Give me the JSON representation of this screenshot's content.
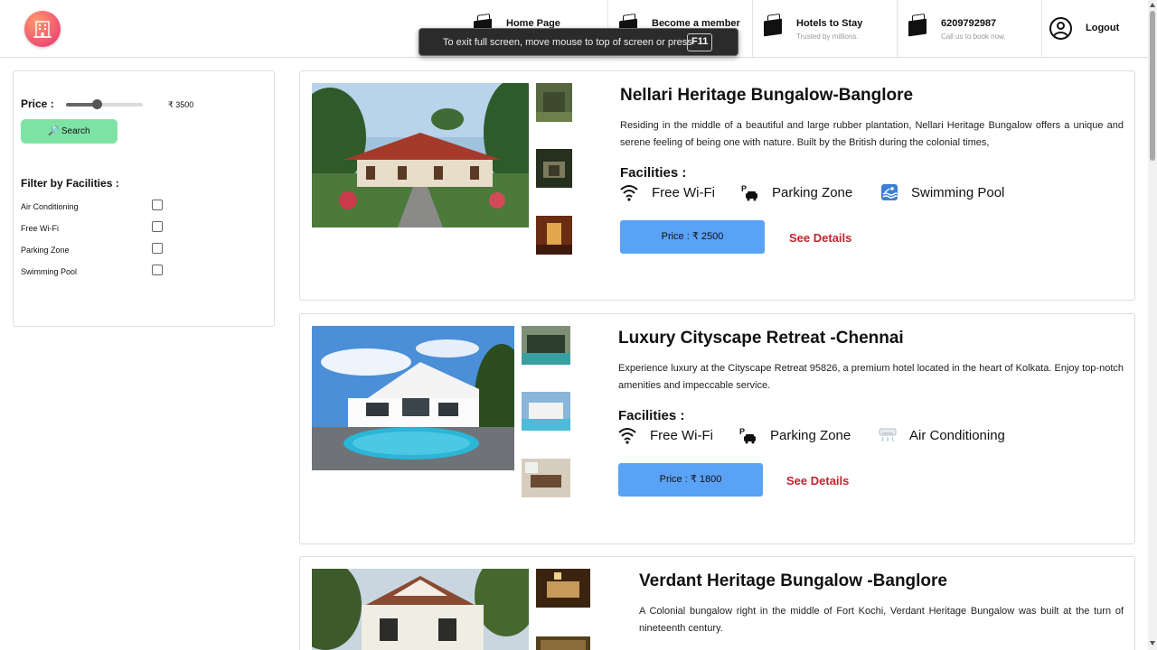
{
  "header": {
    "nav": [
      {
        "title": "Home Page",
        "subtitle": ""
      },
      {
        "title": "Become a member",
        "subtitle": ""
      },
      {
        "title": "Hotels to Stay",
        "subtitle": "Trusted by millions."
      },
      {
        "title": "6209792987",
        "subtitle": "Call us to book now."
      }
    ],
    "logout_label": "Logout"
  },
  "fullscreen_toast": {
    "message": "To exit full screen, move mouse to top of screen or press",
    "key": "F11"
  },
  "sidebar": {
    "price_label": "Price :",
    "price_value": "₹ 3500",
    "price_slider_fraction": 0.4,
    "search_label": "Search",
    "filter_title": "Filter by Facilities :",
    "facilities": [
      "Air Conditioning",
      "Free Wi-Fi",
      "Parking Zone",
      "Swimming Pool"
    ]
  },
  "hotels": [
    {
      "name": "Nellari Heritage Bungalow-Banglore",
      "description": "Residing in the middle of a beautiful and large rubber plantation, Nellari Heritage Bungalow offers a unique and serene feeling of being one with nature. Built by the British during the colonial times,",
      "facilities_title": "Facilities :",
      "facilities": [
        "Free Wi-Fi",
        "Parking Zone",
        "Swimming Pool"
      ],
      "price": "Price : ₹ 2500",
      "details": "See Details"
    },
    {
      "name": "Luxury Cityscape Retreat -Chennai",
      "description": "Experience luxury at the Cityscape Retreat 95826, a premium hotel located in the heart of Kolkata. Enjoy top-notch amenities and impeccable service.",
      "facilities_title": "Facilities :",
      "facilities": [
        "Free Wi-Fi",
        "Parking Zone",
        "Air Conditioning"
      ],
      "price": "Price : ₹ 1800",
      "details": "See Details"
    },
    {
      "name": "Verdant Heritage Bungalow -Banglore",
      "description": "A Colonial bungalow right in the middle of Fort Kochi, Verdant Heritage Bungalow was built at the turn of nineteenth century."
    }
  ]
}
